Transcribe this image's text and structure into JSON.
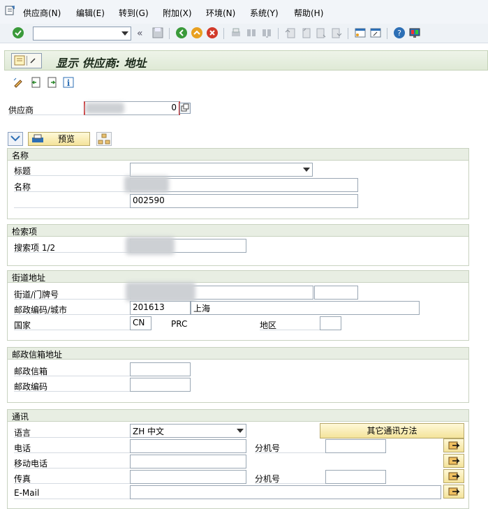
{
  "menu": {
    "items": [
      "供应商(N)",
      "编辑(E)",
      "转到(G)",
      "附加(X)",
      "环境(N)",
      "系统(Y)",
      "帮助(H)"
    ]
  },
  "toolbar": {
    "command_value": "",
    "icons": [
      "check-icon",
      "back-nav-icon",
      "save-icon",
      "back-icon",
      "exit-icon",
      "cancel-icon",
      "print-icon",
      "find-icon",
      "find-next-icon",
      "first-page-icon",
      "prev-page-icon",
      "next-page-icon",
      "last-page-icon",
      "new-session-icon",
      "shortcut-icon",
      "help-icon",
      "customize-icon"
    ]
  },
  "title": "显示 供应商: 地址",
  "vendor": {
    "label": "供应商",
    "value": "0"
  },
  "preview_button": "预览",
  "groups": {
    "name": {
      "title": "名称",
      "title_label": "标题",
      "title_value": "",
      "name_label": "名称",
      "name_value": "",
      "name2_value": "002590"
    },
    "search": {
      "title": "检索项",
      "label": "搜索项 1/2",
      "value": ""
    },
    "street": {
      "title": "街道地址",
      "street_label": "街道/门牌号",
      "street_value": "",
      "house_value": "",
      "postal_city_label": "邮政编码/城市",
      "postal_code": "201613",
      "city": "上海",
      "country_label": "国家",
      "country_code": "CN",
      "country_name": "PRC",
      "region_label": "地区",
      "region_value": ""
    },
    "pobox": {
      "title": "邮政信箱地址",
      "pobox_label": "邮政信箱",
      "pobox_value": "",
      "postal_label": "邮政编码",
      "postal_value": ""
    },
    "comm": {
      "title": "通讯",
      "language_label": "语言",
      "language_value": "ZH 中文",
      "other_button": "其它通讯方法",
      "phone_label": "电话",
      "phone_value": "",
      "ext_label": "分机号",
      "ext_value": "",
      "mobile_label": "移动电话",
      "mobile_value": "",
      "fax_label": "传真",
      "fax_value": "",
      "fax_ext_label": "分机号",
      "fax_ext_value": "",
      "email_label": "E-Mail",
      "email_value": ""
    }
  }
}
